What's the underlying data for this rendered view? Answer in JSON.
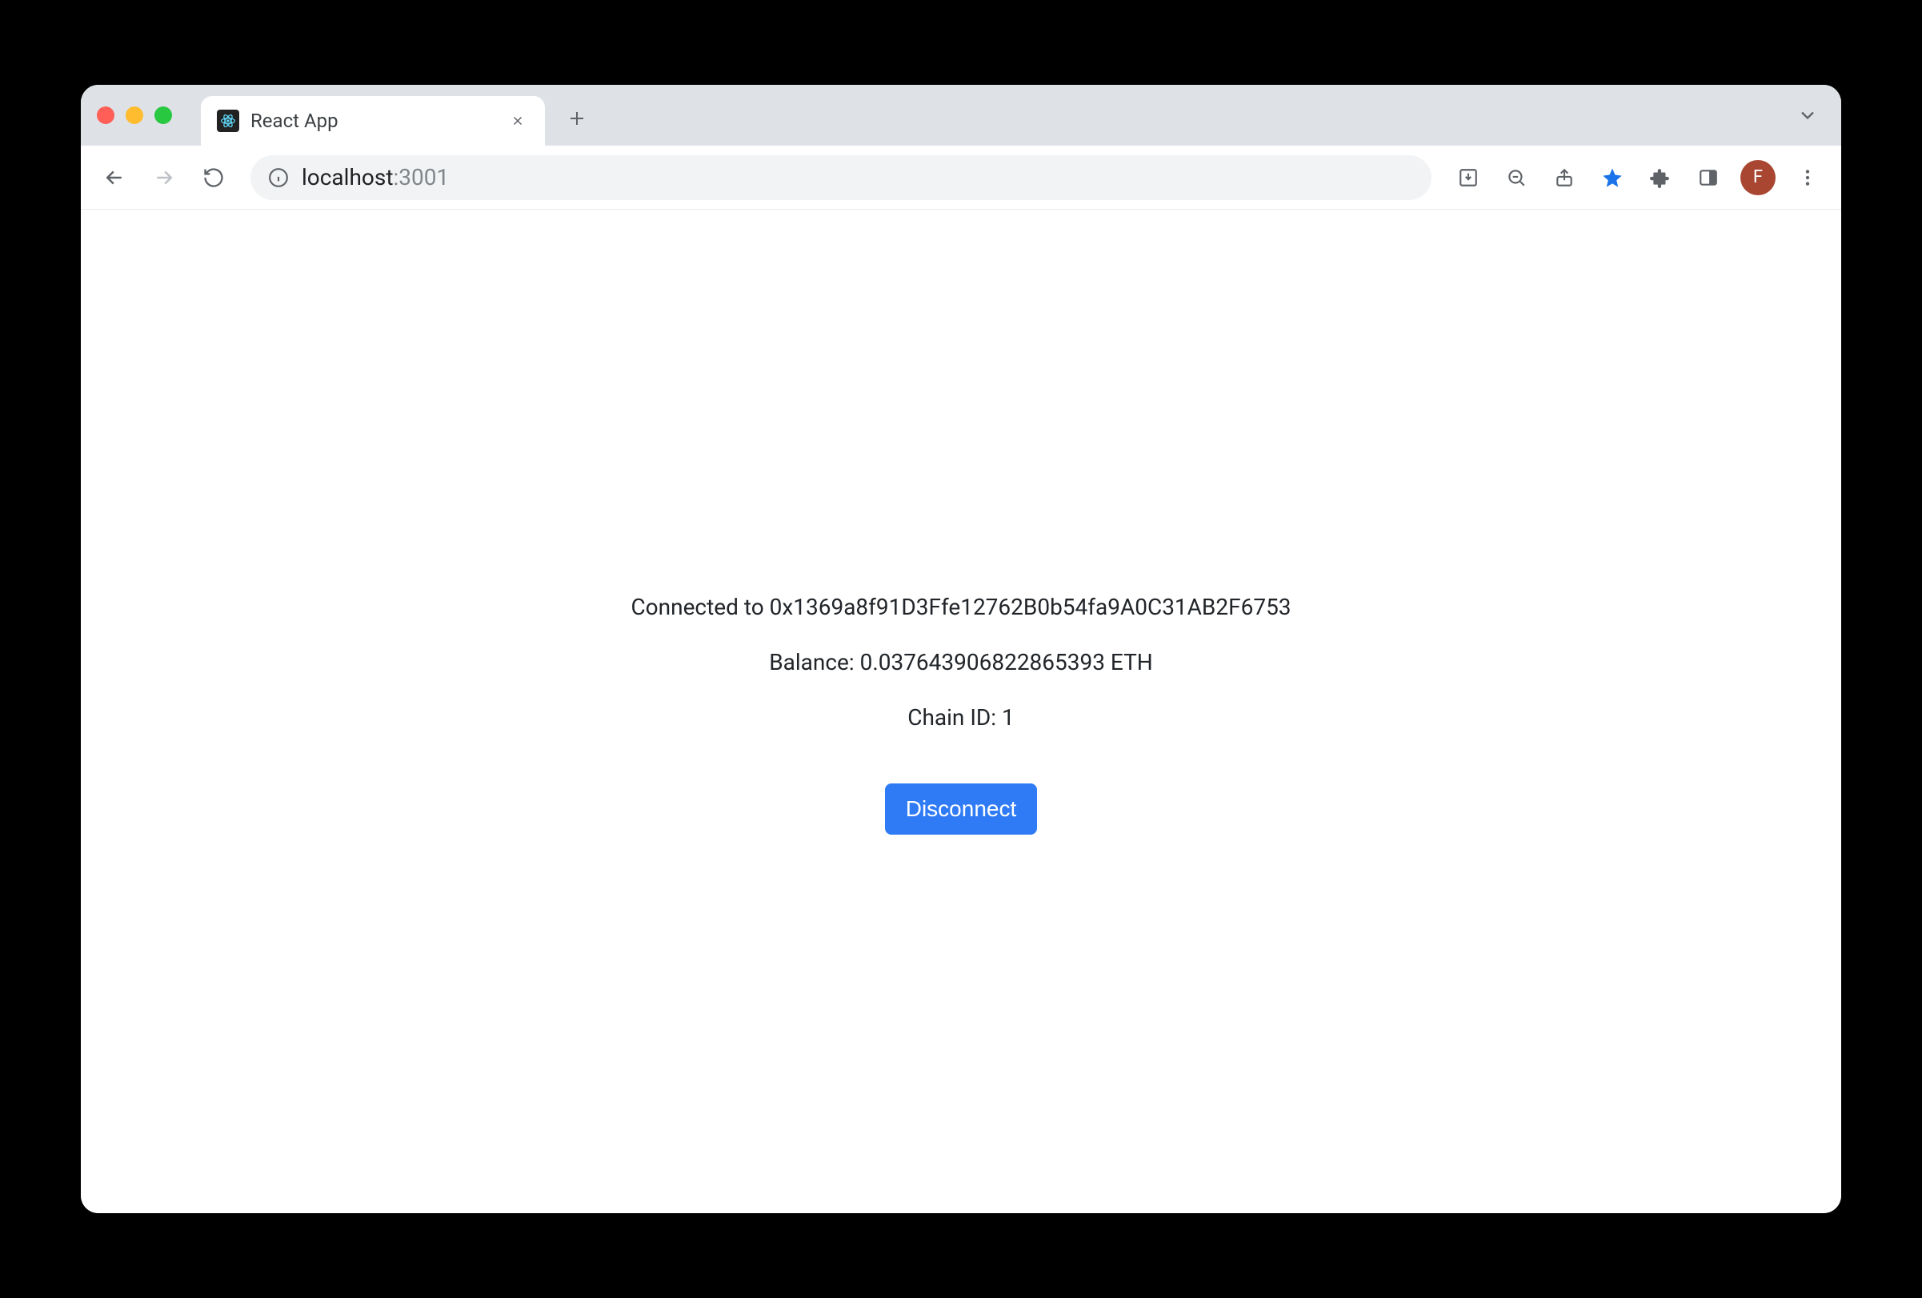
{
  "browser": {
    "tab_title": "React App",
    "url_host": "localhost",
    "url_port": ":3001",
    "avatar_initial": "F"
  },
  "page": {
    "connected_label": "Connected to 0x1369a8f91D3Ffe12762B0b54fa9A0C31AB2F6753",
    "balance_label": "Balance: 0.037643906822865393 ETH",
    "chain_label": "Chain ID: 1",
    "disconnect_label": "Disconnect"
  }
}
